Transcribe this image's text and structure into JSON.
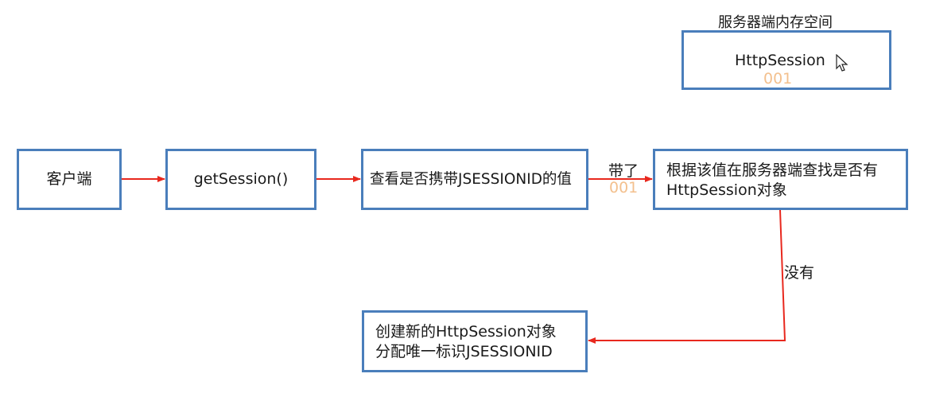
{
  "memory": {
    "caption": "服务器端内存空间",
    "session_title": "HttpSession",
    "session_id": "001"
  },
  "flow": {
    "client": "客户端",
    "get_session": "getSession()",
    "check": "查看是否携带JSESSIONID的值",
    "lookup_line1": "根据该值在服务器端查找是否有",
    "lookup_line2": "HttpSession对象",
    "create_line1": "创建新的HttpSession对象",
    "create_line2": "分配唯一标识JSESSIONID"
  },
  "edges": {
    "carried": "带了",
    "carried_id": "001",
    "none": "没有"
  },
  "colors": {
    "box_border": "#4a7ebb",
    "arrow": "#e8281e",
    "id_text": "#f3c08e"
  },
  "icons": [
    "mouse-cursor-icon",
    "arrow-head-icon"
  ]
}
